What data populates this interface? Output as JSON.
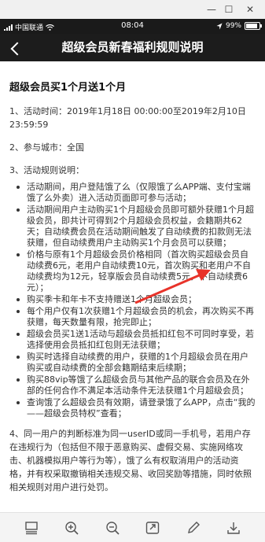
{
  "statusbar": {
    "carrier": "中国联通",
    "time": "08:04",
    "battery": "99%"
  },
  "navbar": {
    "title": "超级会员新春福利规则说明"
  },
  "doc": {
    "heading": "超级会员买1个月送1个月",
    "item1": "1、活动时间：2019年1月18日 00:00:00至2019年2月10日23:59:59",
    "item2": "2、参与城市：全国",
    "item3": "3、活动规则说明：",
    "rules": [
      "活动期间，用户登陆饿了么（仅限饿了么APP端、支付宝端饿了么外卖）进入活动页面即可参与活动；",
      "活动期间用户主动购买1个月超级会员即可额外获赠1个月超级会员，即共计可得到2个月超级会员权益，会籍期共62天；自动续费会员在活动期间触发了自动续费的扣款则无法获赠，但自动续费用户主动购买1个月会员可以获赠；",
      "价格与原有1个月超级会员价格相同（首次购买超级会员自动续费6元，老用户自动续费10元，首次购买和老用户不自动续费均为12元，轻享版会员自动续费5元，不自动续费6元）；",
      "购买季卡和年卡不支持赠送1个月超级会员；",
      "每个用户仅有1次获赠1个月超级会员的机会，再次购买不再获赠，每天数量有限，抢完即止；",
      "超级会员买1送1活动与超级会员抵扣红包不可同时享受，若选择使用会员抵扣红包则无法获赠；",
      "购买时选择自动续费的用户，获赠的1个月超级会员在用户购买或自动续费的全部会籍期结束后续期；",
      "购买88vip等饿了么超级会员与其他产品的联合会员及在外部的任何合作不满足本活动条件无法获赠1个月超级会员；",
      "查询饿了么超级会员有效期，请登录饿了么APP，点击“我的——超级会员特权”查看；"
    ],
    "item4": "4、同一用户的判断标准为同一userID或同一手机号，若用户存在违规行为（包括但不限于恶意购买、虚假交易、实施网络攻击、机器模拟用户等行为等），饿了么有权取消用户的活动资格，并有权采取撤销相关违规交易、收回奖励等措施，同时依照相关规则对用户进行处罚。"
  },
  "colors": {
    "navbar": "#1c1c1c",
    "arrow": "#e8332a",
    "statusbar": "#1a1a1a"
  },
  "toolbar": {
    "icons": [
      "layout-icon",
      "zoom-in-icon",
      "zoom-out-icon",
      "share-icon",
      "edit-icon",
      "download-icon"
    ]
  }
}
